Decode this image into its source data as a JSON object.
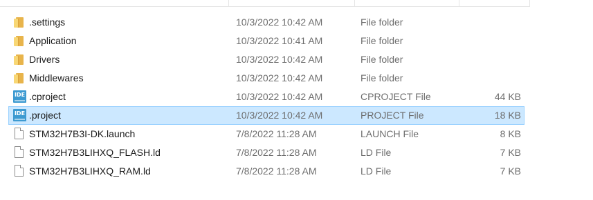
{
  "files": [
    {
      "name": ".settings",
      "date": "10/3/2022 10:42 AM",
      "type": "File folder",
      "size": "",
      "icon": "folder-icon",
      "selected": false
    },
    {
      "name": "Application",
      "date": "10/3/2022 10:41 AM",
      "type": "File folder",
      "size": "",
      "icon": "folder-icon",
      "selected": false
    },
    {
      "name": "Drivers",
      "date": "10/3/2022 10:42 AM",
      "type": "File folder",
      "size": "",
      "icon": "folder-icon",
      "selected": false
    },
    {
      "name": "Middlewares",
      "date": "10/3/2022 10:42 AM",
      "type": "File folder",
      "size": "",
      "icon": "folder-icon",
      "selected": false
    },
    {
      "name": ".cproject",
      "date": "10/3/2022 10:42 AM",
      "type": "CPROJECT File",
      "size": "44 KB",
      "icon": "ide-icon",
      "selected": false
    },
    {
      "name": ".project",
      "date": "10/3/2022 10:42 AM",
      "type": "PROJECT File",
      "size": "18 KB",
      "icon": "ide-icon",
      "selected": true
    },
    {
      "name": "STM32H7B3I-DK.launch",
      "date": "7/8/2022 11:28 AM",
      "type": "LAUNCH File",
      "size": "8 KB",
      "icon": "file-icon",
      "selected": false
    },
    {
      "name": "STM32H7B3LIHXQ_FLASH.ld",
      "date": "7/8/2022 11:28 AM",
      "type": "LD File",
      "size": "7 KB",
      "icon": "file-icon",
      "selected": false
    },
    {
      "name": "STM32H7B3LIHXQ_RAM.ld",
      "date": "7/8/2022 11:28 AM",
      "type": "LD File",
      "size": "7 KB",
      "icon": "file-icon",
      "selected": false
    }
  ],
  "icon_text": {
    "ide": "IDE"
  },
  "colors": {
    "selection_bg": "#cce8ff",
    "selection_border": "#99d1ff",
    "folder": "#f8d775",
    "ide_icon": "#3d9ad1",
    "secondary_text": "#6d6d6d"
  }
}
